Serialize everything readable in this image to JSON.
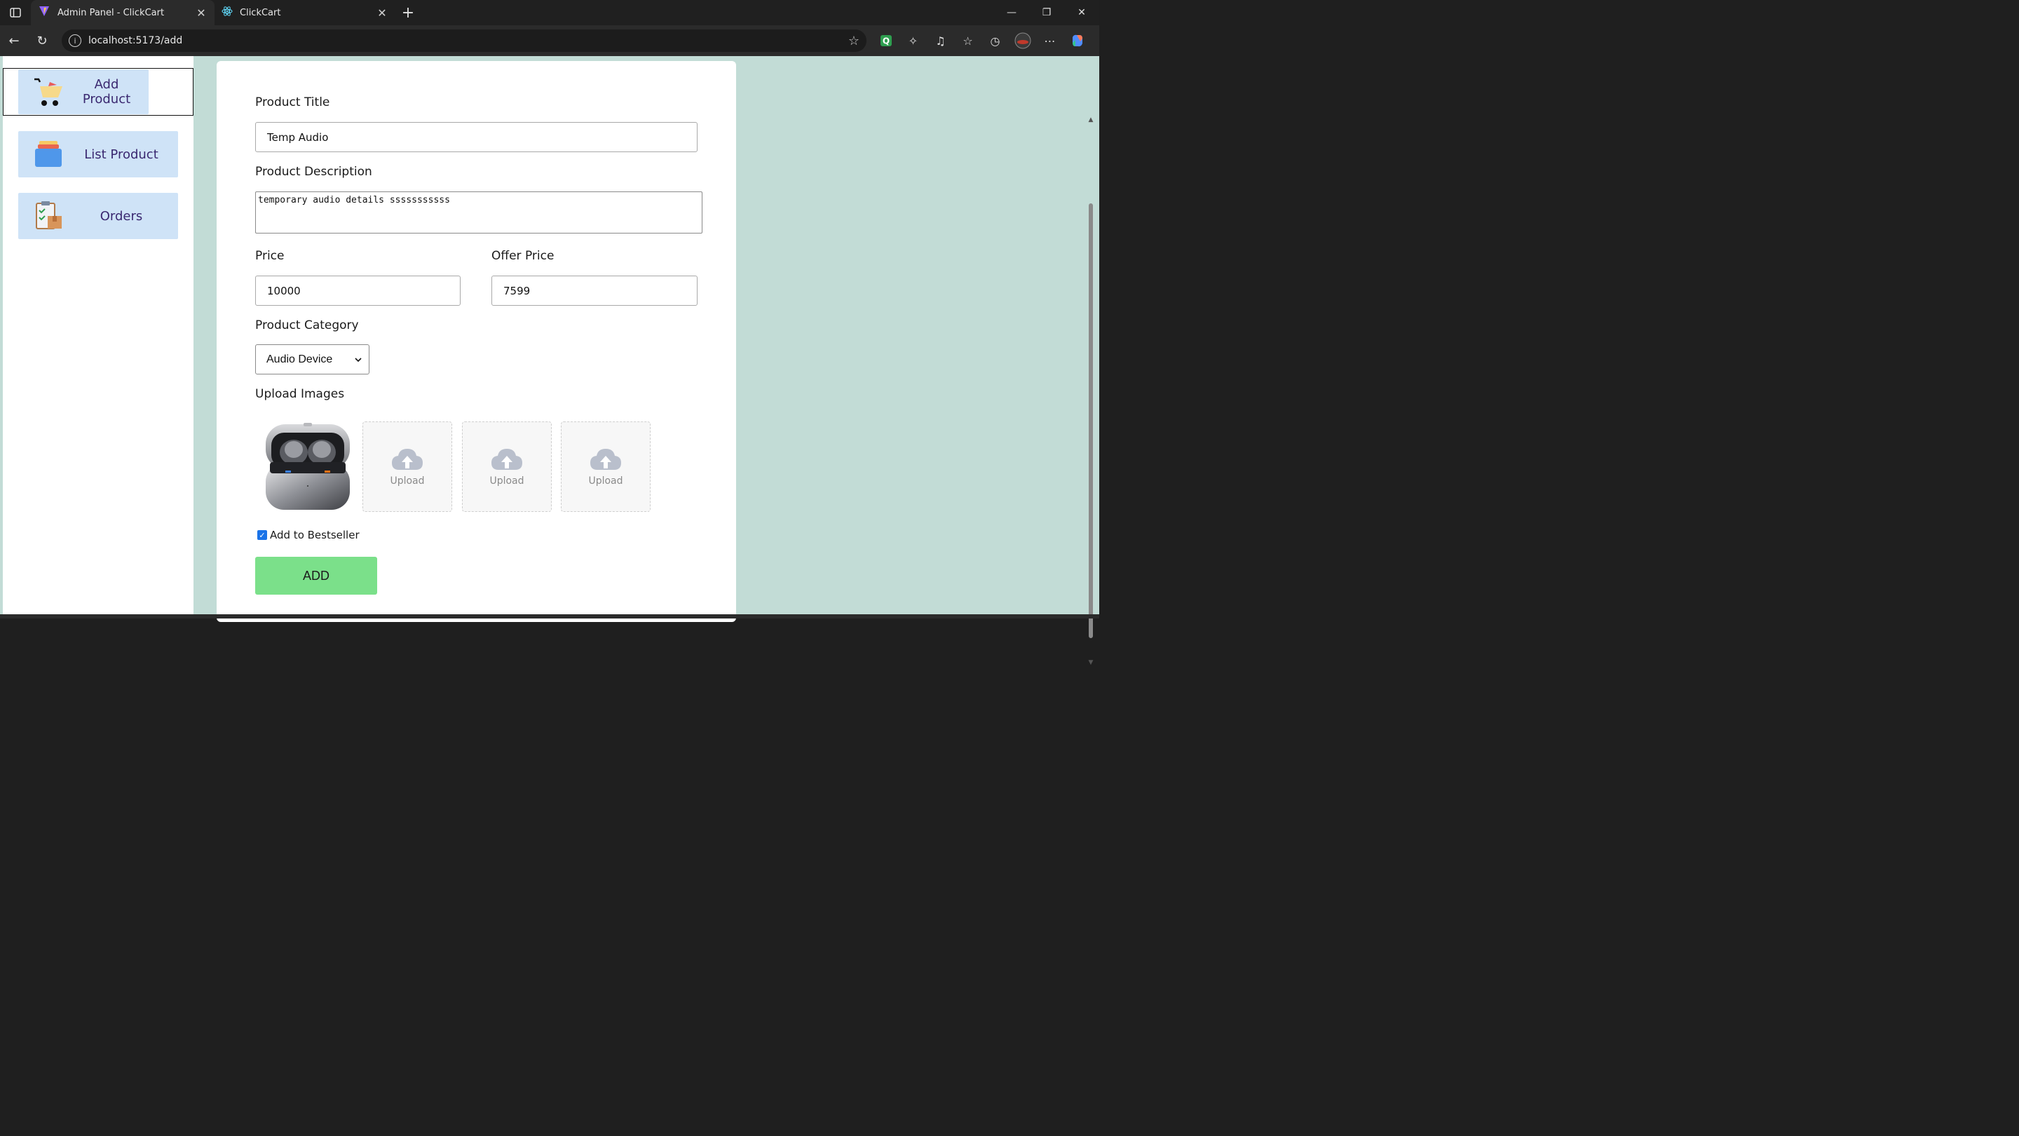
{
  "browser": {
    "tabs": [
      {
        "title": "Admin Panel - ClickCart",
        "active": true
      },
      {
        "title": "ClickCart",
        "active": false
      }
    ],
    "url": "localhost:5173/add"
  },
  "sidebar": {
    "items": [
      {
        "label": "Add Product",
        "icon": "cart-icon",
        "active": true
      },
      {
        "label": "List Product",
        "icon": "stack-icon",
        "active": false
      },
      {
        "label": "Orders",
        "icon": "clipboard-box-icon",
        "active": false
      }
    ]
  },
  "form": {
    "title_label": "Product Title",
    "title_value": "Temp Audio",
    "description_label": "Product Description",
    "description_value": "temporary audio details sssssssssss",
    "price_label": "Price",
    "price_value": "10000",
    "offer_price_label": "Offer Price",
    "offer_price_value": "7599",
    "category_label": "Product Category",
    "category_selected": "Audio Device",
    "upload_label": "Upload Images",
    "upload_slot_label": "Upload",
    "bestseller_label": "Add to Bestseller",
    "bestseller_checked": true,
    "submit_label": "ADD"
  },
  "colors": {
    "page_bg": "#c2dcd6",
    "sidebar_item_bg": "#cfe3f7",
    "sidebar_text": "#3a2870",
    "add_button_bg": "#7be08a"
  }
}
